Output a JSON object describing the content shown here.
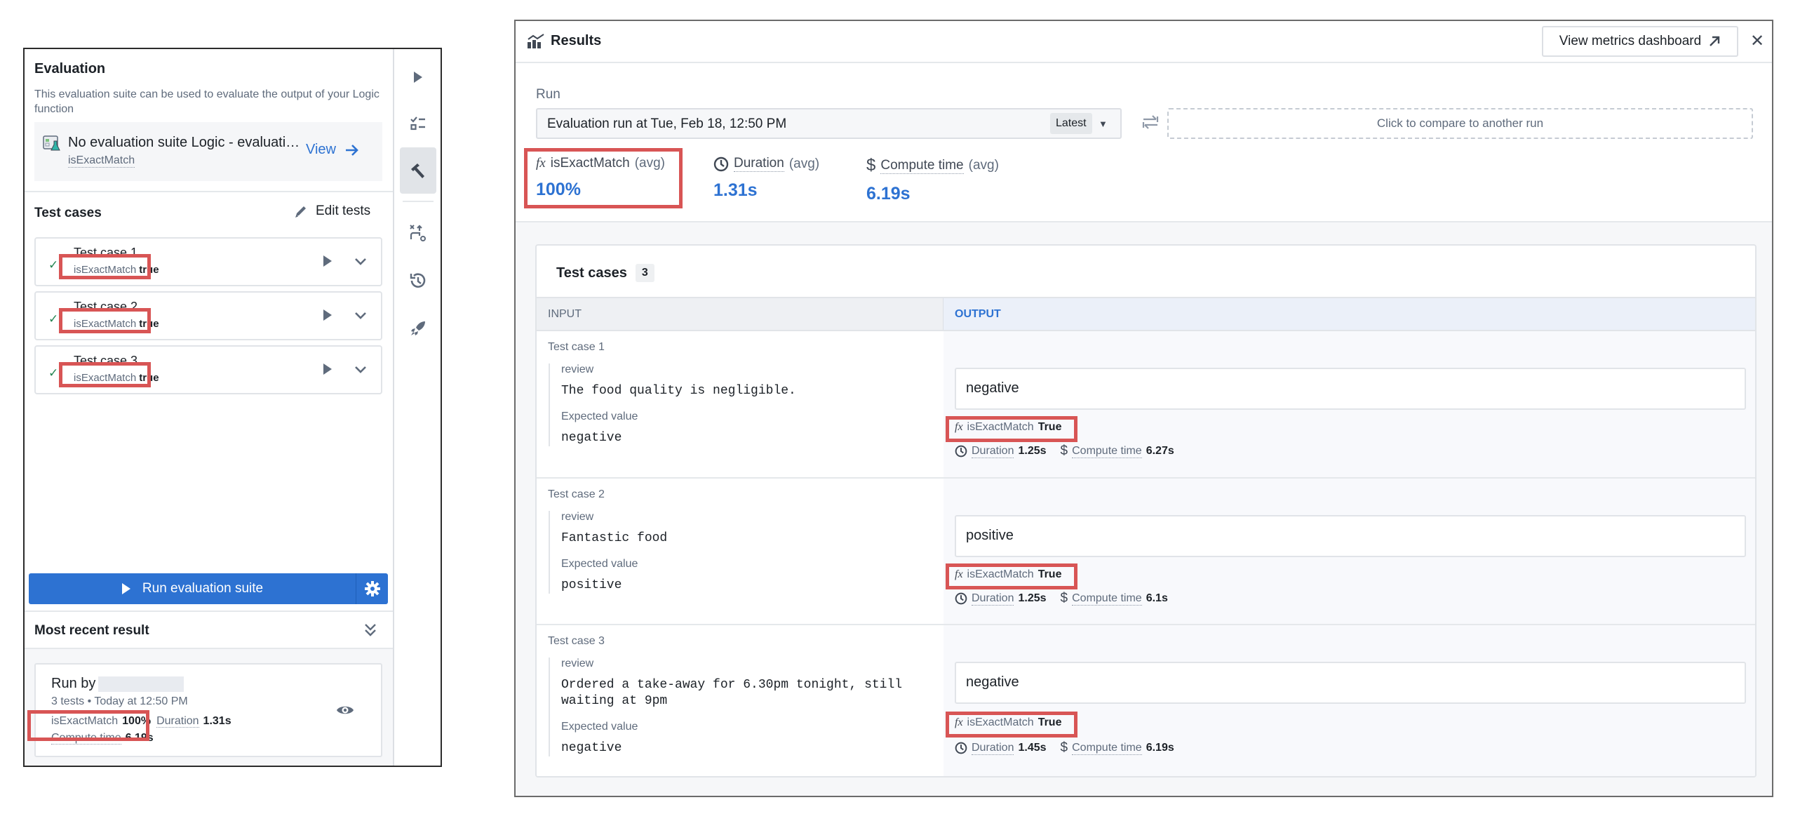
{
  "evaluation_panel": {
    "title": "Evaluation",
    "description": "This evaluation suite can be used to evaluate the output of your Logic function",
    "suite": {
      "name": "No evaluation suite Logic - evaluati…",
      "function": "isExactMatch",
      "view_label": "View"
    },
    "test_cases_heading": "Test cases",
    "edit_tests_label": "Edit tests",
    "test_cases": [
      {
        "name": "Test case 1",
        "metric": "isExactMatch",
        "value": "true",
        "status": "passed"
      },
      {
        "name": "Test case 2",
        "metric": "isExactMatch",
        "value": "true",
        "status": "passed"
      },
      {
        "name": "Test case 3",
        "metric": "isExactMatch",
        "value": "true",
        "status": "passed"
      }
    ],
    "run_button_label": "Run evaluation suite",
    "most_recent_result": {
      "title": "Most recent result",
      "run_by_label": "Run by",
      "meta": "3 tests • Today at 12:50 PM",
      "metric_name": "isExactMatch",
      "metric_value": "100%",
      "duration_label": "Duration",
      "duration_value": "1.31s",
      "compute_label": "Compute time",
      "compute_value": "6.19s"
    }
  },
  "sidebar": {
    "icons": [
      "play-icon",
      "checklist-icon",
      "hammer-icon",
      "variable-flow-icon",
      "history-icon",
      "rocket-icon"
    ],
    "active": "hammer-icon"
  },
  "results_panel": {
    "title": "Results",
    "metrics_dashboard_label": "View metrics dashboard",
    "close_label": "✕",
    "run_label": "Run",
    "run_selected": "Evaluation run at Tue, Feb 18, 12:50 PM",
    "run_tag": "Latest",
    "compare_placeholder": "Click to compare to another run",
    "stats": [
      {
        "icon": "fx",
        "name": "isExactMatch",
        "suffix": "(avg)",
        "value": "100%"
      },
      {
        "icon": "clock",
        "name": "Duration",
        "suffix": "(avg)",
        "value": "1.31s"
      },
      {
        "icon": "dollar",
        "name": "Compute time",
        "suffix": "(avg)",
        "value": "6.19s"
      }
    ],
    "table": {
      "title": "Test cases",
      "count": "3",
      "input_header": "INPUT",
      "output_header": "OUTPUT",
      "rows": [
        {
          "name": "Test case 1",
          "field": "review",
          "input": "The food quality is negligible.",
          "expected_label": "Expected value",
          "expected": "negative",
          "output": "negative",
          "metric": "isExactMatch",
          "metric_value": "True",
          "duration_label": "Duration",
          "duration": "1.25s",
          "compute_label": "Compute time",
          "compute": "6.27s"
        },
        {
          "name": "Test case 2",
          "field": "review",
          "input": "Fantastic food",
          "expected_label": "Expected value",
          "expected": "positive",
          "output": "positive",
          "metric": "isExactMatch",
          "metric_value": "True",
          "duration_label": "Duration",
          "duration": "1.25s",
          "compute_label": "Compute time",
          "compute": "6.1s"
        },
        {
          "name": "Test case 3",
          "field": "review",
          "input": "Ordered a take-away for 6.30pm tonight, still waiting at 9pm",
          "expected_label": "Expected value",
          "expected": "negative",
          "output": "negative",
          "metric": "isExactMatch",
          "metric_value": "True",
          "duration_label": "Duration",
          "duration": "1.45s",
          "compute_label": "Compute time",
          "compute": "6.19s"
        }
      ]
    }
  },
  "colors": {
    "accent": "#2d72d2",
    "success": "#238551",
    "highlight": "#d85555"
  }
}
